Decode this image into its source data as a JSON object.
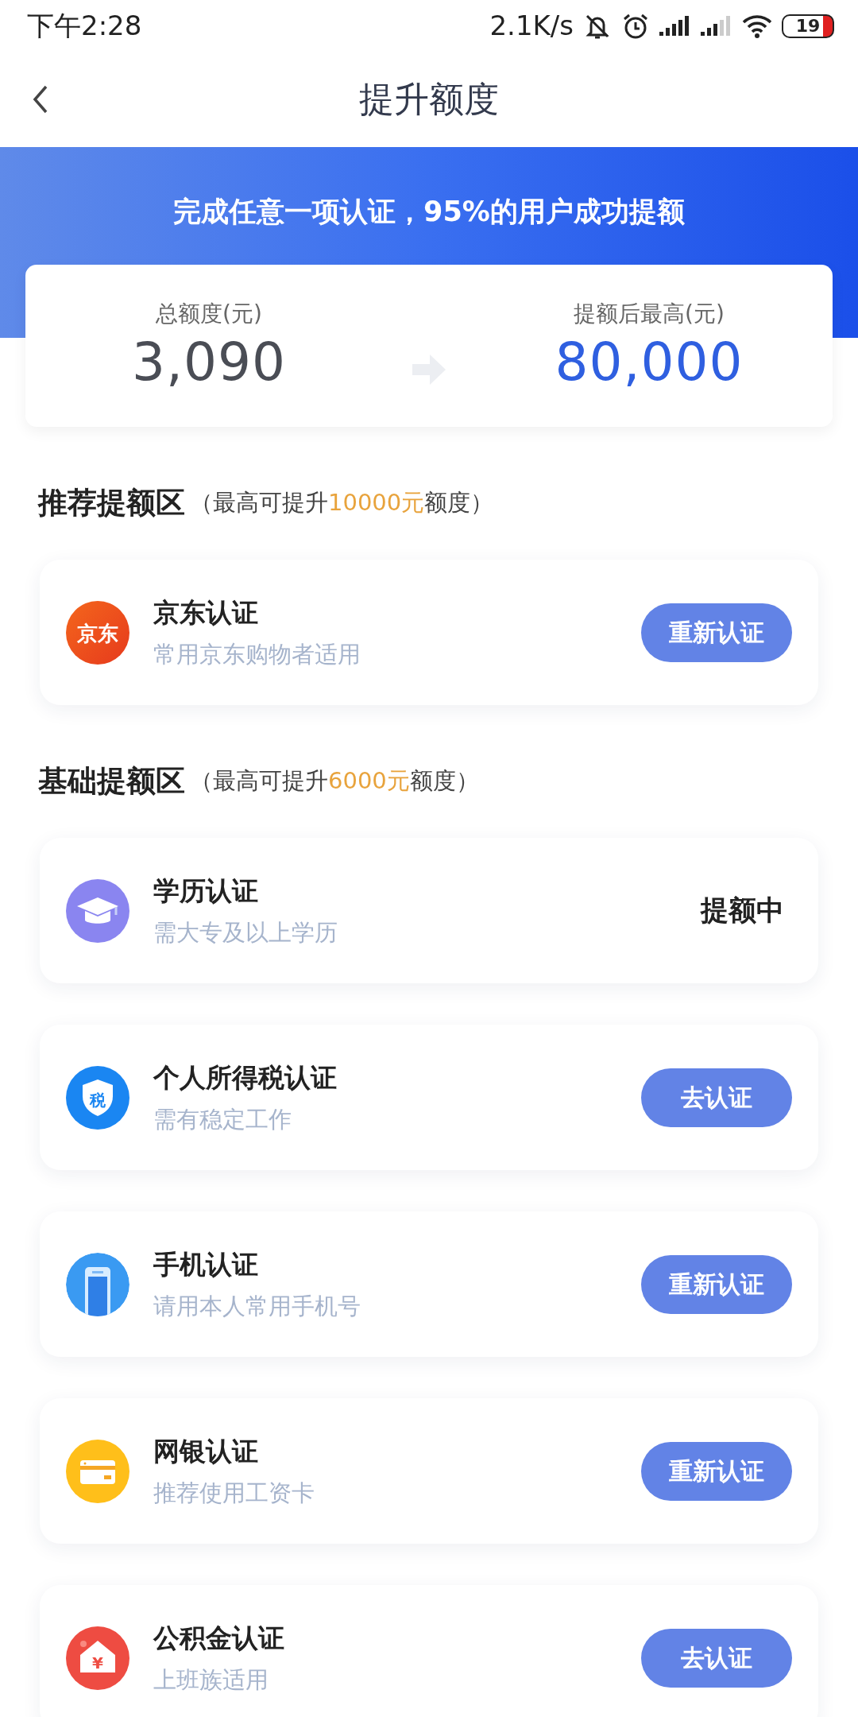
{
  "status_bar": {
    "time": "下午2:28",
    "network_speed": "2.1K/s",
    "battery": "19"
  },
  "header": {
    "title": "提升额度"
  },
  "banner": {
    "text": "完成任意一项认证，95%的用户成功提额"
  },
  "summary": {
    "current_label": "总额度(元)",
    "current_value": "3,090",
    "max_label": "提额后最高(元)",
    "max_value": "80,000"
  },
  "sections": [
    {
      "title": "推荐提额区",
      "note_prefix": "（最高可提升",
      "note_highlight": "10000元",
      "note_suffix": "额度）",
      "items": [
        {
          "title": "京东认证",
          "subtitle": "常用京东购物者适用",
          "kind": "jd",
          "icon_text": "京东",
          "action": {
            "kind": "button",
            "label": "重新认证"
          }
        }
      ]
    },
    {
      "title": "基础提额区",
      "note_prefix": "（最高可提升",
      "note_highlight": "6000元",
      "note_suffix": "额度）",
      "items": [
        {
          "title": "学历认证",
          "subtitle": "需大专及以上学历",
          "kind": "graduation",
          "action": {
            "kind": "status",
            "label": "提额中"
          }
        },
        {
          "title": "个人所得税认证",
          "subtitle": "需有稳定工作",
          "kind": "tax",
          "icon_text": "税",
          "action": {
            "kind": "button",
            "label": "去认证"
          }
        },
        {
          "title": "手机认证",
          "subtitle": "请用本人常用手机号",
          "kind": "phone",
          "action": {
            "kind": "button",
            "label": "重新认证"
          }
        },
        {
          "title": "网银认证",
          "subtitle": "推荐使用工资卡",
          "kind": "card",
          "action": {
            "kind": "button",
            "label": "重新认证"
          }
        },
        {
          "title": "公积金认证",
          "subtitle": "上班族适用",
          "kind": "house",
          "icon_text": "¥",
          "action": {
            "kind": "button",
            "label": "去认证"
          }
        }
      ]
    }
  ]
}
